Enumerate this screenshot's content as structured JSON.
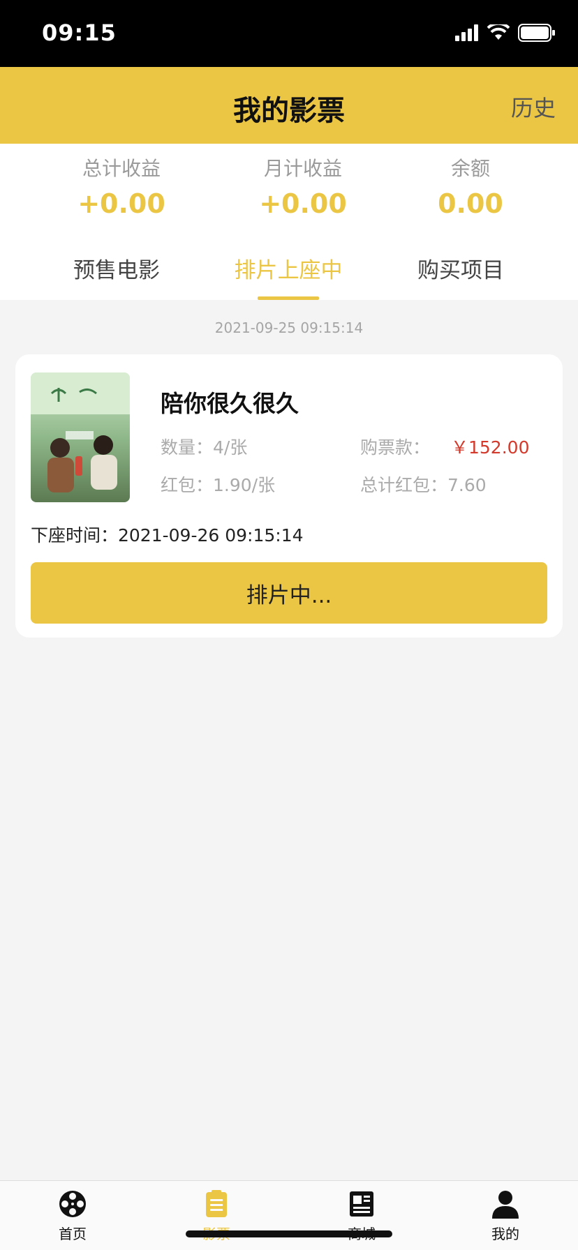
{
  "status": {
    "time": "09:15"
  },
  "header": {
    "title": "我的影票",
    "history": "历史"
  },
  "stats": [
    {
      "label": "总计收益",
      "value": "+0.00"
    },
    {
      "label": "月计收益",
      "value": "+0.00"
    },
    {
      "label": "余额",
      "value": "0.00"
    }
  ],
  "tabs": [
    {
      "label": "预售电影"
    },
    {
      "label": "排片上座中"
    },
    {
      "label": "购买项目"
    }
  ],
  "active_tab": 1,
  "order": {
    "timestamp": "2021-09-25 09:15:14",
    "movie_title": "陪你很久很久",
    "quantity": "数量：4/张",
    "payment_label": "购票款：",
    "payment_value": "￥152.00",
    "red_packet": "红包：1.90/张",
    "total_red_packet": "总计红包：7.60",
    "offline_time": "下座时间：2021-09-26 09:15:14",
    "action_label": "排片中..."
  },
  "nav": [
    {
      "label": "首页",
      "icon": "film-reel-icon"
    },
    {
      "label": "影票",
      "icon": "ticket-clipboard-icon"
    },
    {
      "label": "商城",
      "icon": "newspaper-icon"
    },
    {
      "label": "我的",
      "icon": "user-icon"
    }
  ],
  "colors": {
    "accent": "#ebc544",
    "price": "#d33a2c",
    "background": "#f4f4f4"
  }
}
